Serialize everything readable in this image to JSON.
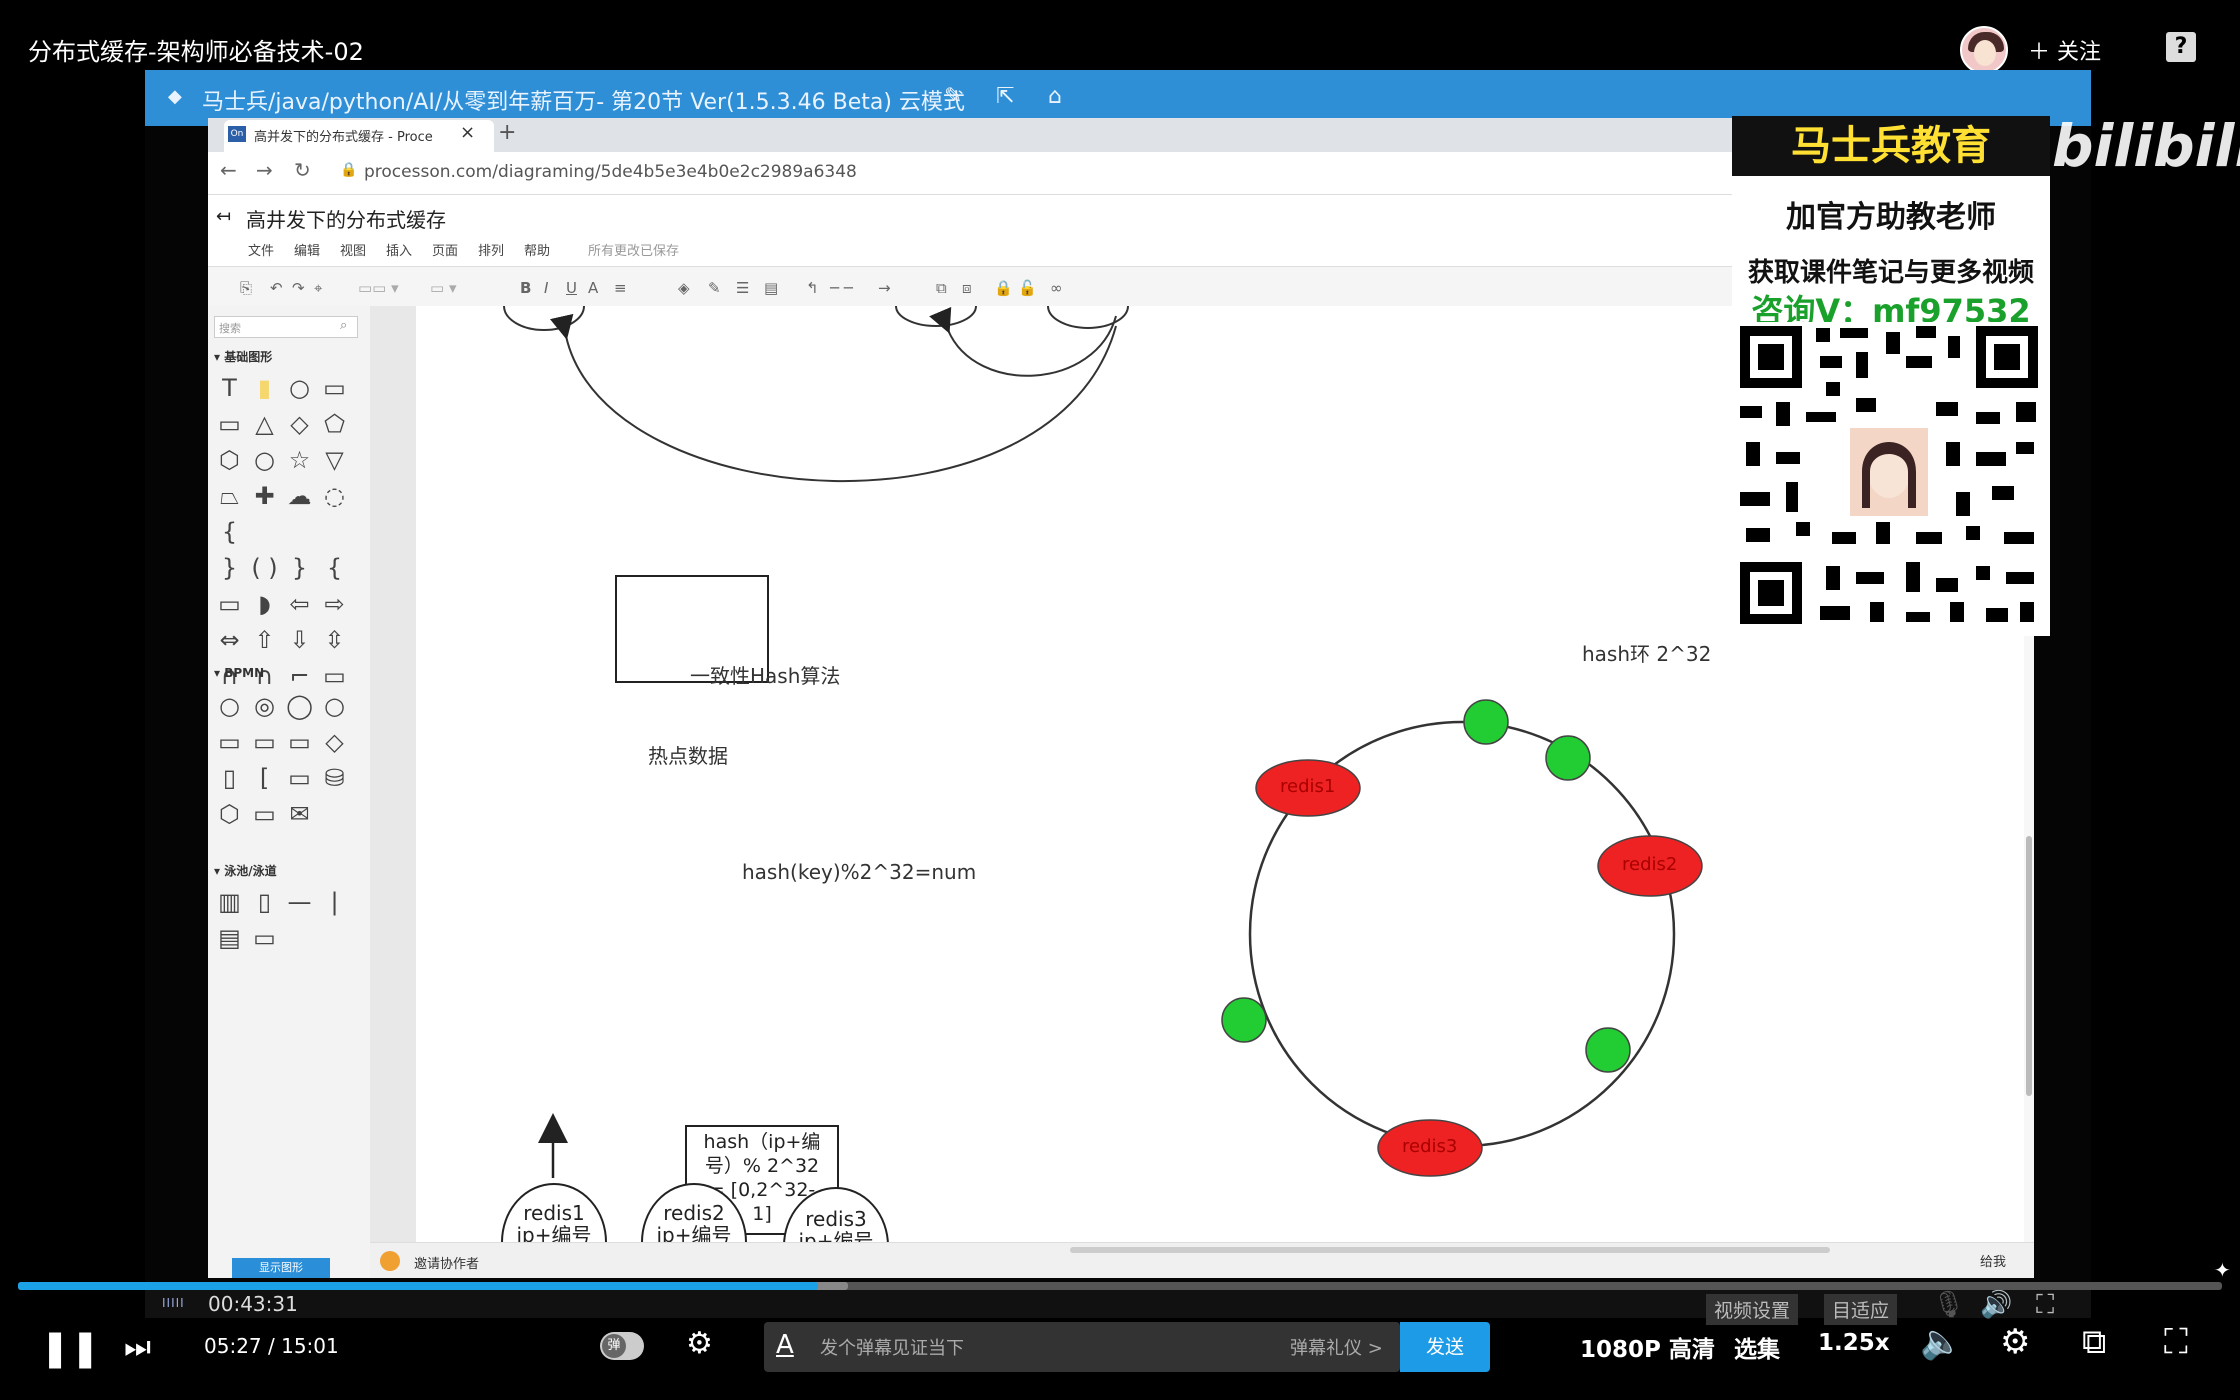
{
  "video_title": "分布式缓存-架构师必备技术-02",
  "follow_label": "＋ 关注",
  "help_label": "?",
  "app_window": {
    "title": "马士兵/java/python/AI/从零到年薪百万- 第20节 Ver(1.5.3.46 Beta)  云模式",
    "icons": [
      "edit-icon",
      "share-icon",
      "home-icon"
    ]
  },
  "browser": {
    "tab_label": "高并发下的分布式缓存 - Proce",
    "tab_logo": "On",
    "tab_close": "×",
    "new_tab": "+",
    "url": "processon.com/diagraming/5de4b5e3e4b0e2c2989a6348"
  },
  "editor": {
    "doc_title": "高井发下的分布式缓存",
    "menus": [
      "文件",
      "编辑",
      "视图",
      "插入",
      "页面",
      "排列",
      "帮助"
    ],
    "save_status": "所有更改已保存",
    "search_placeholder": "搜索",
    "panel_sections": [
      "基础图形",
      "BPMN",
      "泳池/泳道"
    ],
    "footer_button": "显示图形",
    "invite": "邀请协作者",
    "right_corner": "给我"
  },
  "diagram": {
    "algo_label": "一致性Hash算法",
    "hot_data": "热点数据",
    "hash_formula": "hash(key)%2^32=num",
    "ring_label": "hash环  2^32",
    "node_box": [
      "hash（ip+编",
      "号）% 2^32",
      "= [0,2^32-",
      "1]"
    ],
    "redis_nodes_ring": [
      "redis1",
      "redis2",
      "redis3"
    ],
    "redis_circles": [
      {
        "name": "redis1",
        "sub": "ip+编号"
      },
      {
        "name": "redis2",
        "sub": "ip+编号"
      },
      {
        "name": "redis3",
        "sub": "ip+编号"
      }
    ],
    "colors": {
      "red_node": "#ee2222",
      "green_node": "#22cc33"
    }
  },
  "promo": {
    "brand": "马士兵教育",
    "line1": "加官方助教老师",
    "line2": "获取课件笔记与更多视频",
    "line3": "咨询V：mf97532",
    "watermark": "bilibili"
  },
  "inner_player": {
    "time": "00:43:31",
    "bars": "IIIII",
    "buttons": [
      "视频设置",
      "目适应"
    ]
  },
  "player": {
    "current_time": "05:27",
    "separator": "/",
    "total_time": "15:01",
    "progress": 0.363,
    "danmaku_icon": "弹",
    "danmaku_placeholder": "发个弹幕见证当下",
    "danmaku_etiquette": "弹幕礼仪 >",
    "send": "发送",
    "quality": "1080P 高清",
    "episodes": "选集",
    "speed": "1.25x"
  }
}
